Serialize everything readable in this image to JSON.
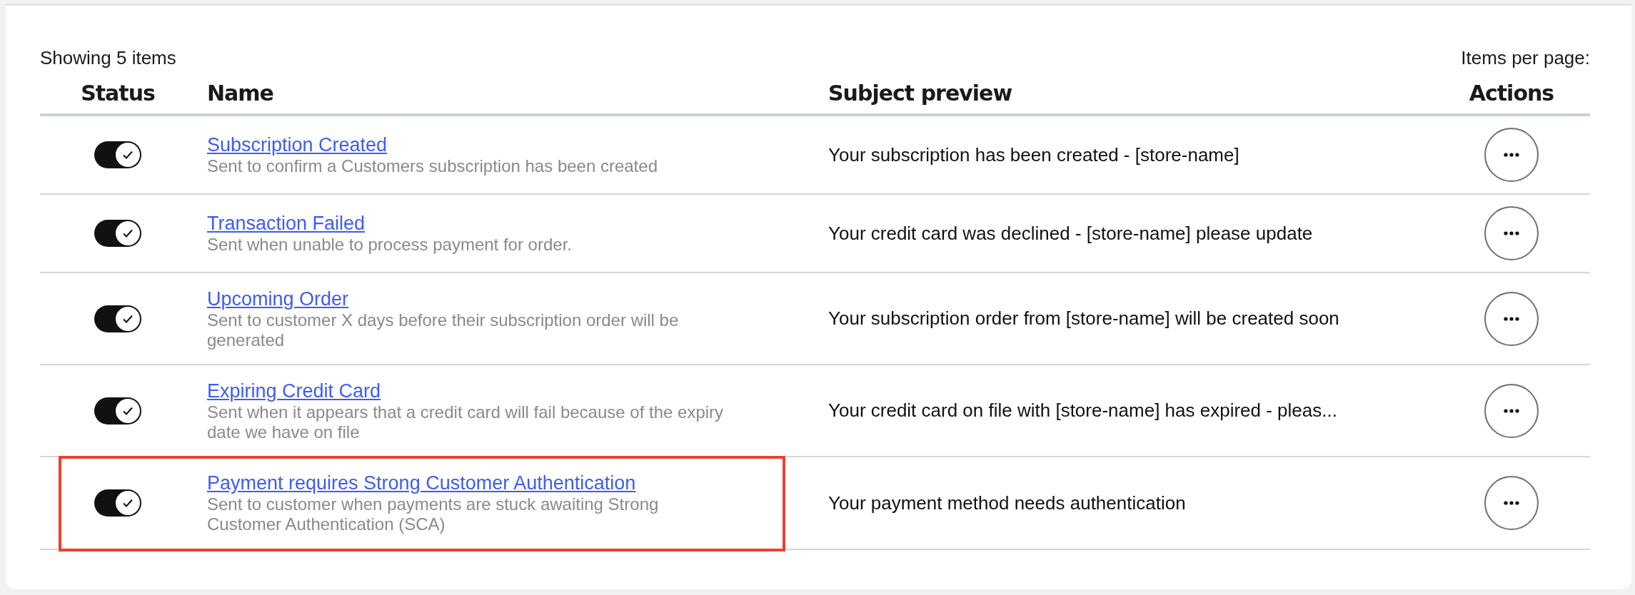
{
  "summary": "Showing 5 items",
  "items_per_page_label": "Items per page:",
  "columns": [
    "Status",
    "Name",
    "Subject preview",
    "Actions"
  ],
  "rows": [
    {
      "on": true,
      "name": "Subscription Created",
      "description": "Sent to confirm a Customers subscription has been created",
      "subject": "Your subscription has been created - [store-name]",
      "highlighted": false
    },
    {
      "on": true,
      "name": "Transaction Failed",
      "description": "Sent when unable to process payment for order.",
      "subject": "Your credit card was declined - [store-name] please update",
      "highlighted": false
    },
    {
      "on": true,
      "name": "Upcoming Order",
      "description": "Sent to customer X days before their subscription order will be generated",
      "subject": "Your subscription order from [store-name] will be created soon",
      "highlighted": false
    },
    {
      "on": true,
      "name": "Expiring Credit Card",
      "description": "Sent when it appears that a credit card will fail because of the expiry date we have on file",
      "subject": "Your credit card on file with [store-name] has expired - pleas...",
      "highlighted": false
    },
    {
      "on": true,
      "name": "Payment requires Strong Customer Authentication",
      "description": "Sent to customer when payments are stuck awaiting Strong Customer Authentication (SCA)",
      "subject": "Your payment method needs authentication",
      "highlighted": true
    }
  ]
}
